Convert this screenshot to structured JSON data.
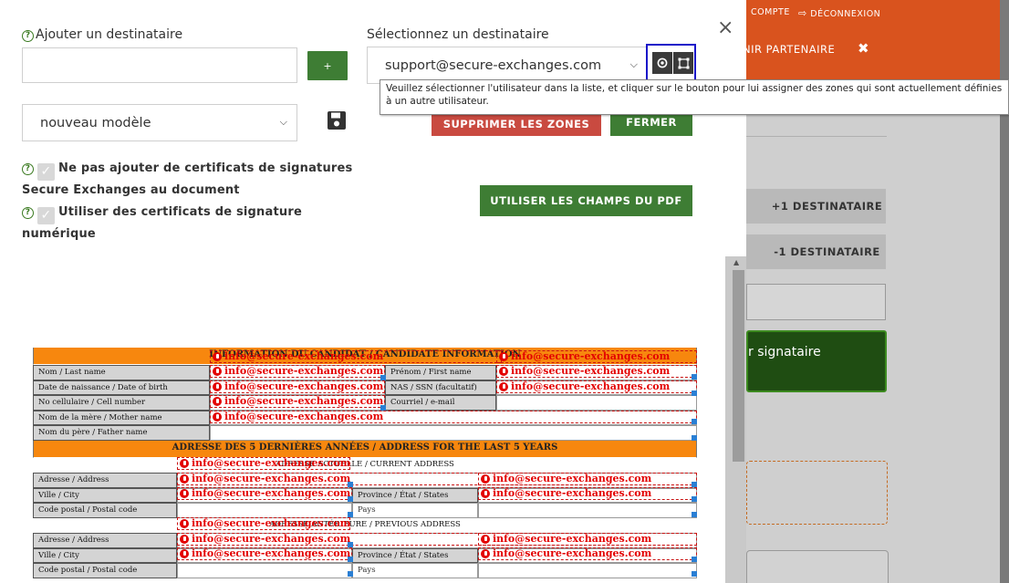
{
  "header": {
    "compte": "COMPTE",
    "deconnexion": "DÉCONNEXION",
    "menu_partenaire": "NIR PARTENAIRE"
  },
  "side": {
    "plus_destinataire": "+1 DESTINATAIRE",
    "minus_destinataire": "-1 DESTINATAIRE",
    "signataire_btn": "r signataire"
  },
  "modal": {
    "add_label": "Ajouter un destinataire",
    "add_value": "",
    "plus_label": "+",
    "select_label": "Sélectionnez un destinataire",
    "selected_recipient": "support@secure-exchanges.com",
    "template_value": "nouveau modèle",
    "tooltip": "Veuillez sélectionner l'utilisateur dans la liste, et cliquer sur le bouton pour lui assigner des zones qui sont actuellement définies à un autre utilisateur.",
    "delete_zones": "SUPPRIMER LES ZONES",
    "close_label": "FERMER",
    "use_pdf_fields": "UTILISER LES CHAMPS DU PDF",
    "check1_line1": "Ne pas ajouter de certificats de signatures",
    "check1_line2": "Secure Exchanges au document",
    "check2_line1": "Utiliser des certificats de signature",
    "check2_line2": "numérique",
    "close_x": "×"
  },
  "form": {
    "section1": "INFORMATION DU CANDIDAT / CANDIDATE INFORMATION",
    "section2": "ADRESSE DES 5 DERNIÈRES ANNÉES / ADDRESS FOR THE LAST 5 YEARS",
    "sub_current": "ADRESSE ACTUELLE / CURRENT ADDRESS",
    "sub_previous": "ADRESSE ANTÉRIEURE / PREVIOUS ADDRESS",
    "nom": "Nom / Last name",
    "prenom": "Prénom / First name",
    "dob": "Date de naissance / Date of birth",
    "nas": "NAS / SSN (facultatif)",
    "cell": "No cellulaire / Cell number",
    "courriel": "Courriel / e-mail",
    "mother": "Nom de la mère / Mother name",
    "father": "Nom du père / Father name",
    "adresse": "Adresse / Address",
    "ville": "Ville / City",
    "province": "Province / État / States",
    "postal": "Code postal / Postal code",
    "pays": "Pays",
    "field_email": "info@secure-exchanges.com"
  },
  "colors": {
    "header_orange": "#d9531e",
    "form_orange": "#f7870e",
    "green": "#3e7d34",
    "red": "#c94a40",
    "field_red": "#e30000",
    "highlight_blue": "#1a14c9"
  },
  "icons": [
    "help-icon",
    "save-icon",
    "target-icon",
    "transfer-zones-icon",
    "close-icon",
    "chevron-down-icon",
    "tools-icon",
    "logout-icon",
    "info-pin-icon",
    "check-icon"
  ]
}
